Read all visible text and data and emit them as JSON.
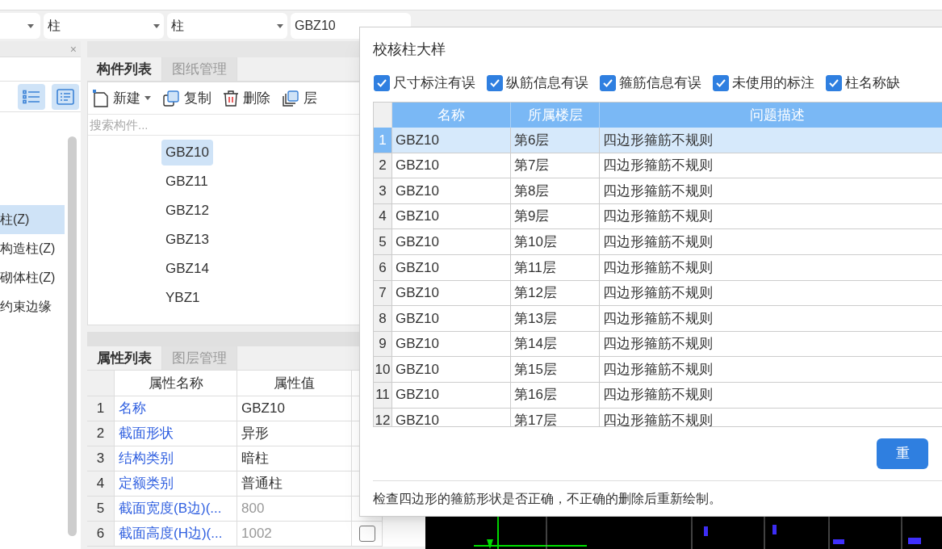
{
  "selectors": [
    {
      "value": "柱"
    },
    {
      "value": "柱"
    },
    {
      "value": "GBZ10"
    }
  ],
  "left_panel": {
    "close": "×",
    "view_buttons": [
      {
        "kind": "list",
        "selected": true
      },
      {
        "kind": "detail",
        "selected": true
      }
    ],
    "items": [
      {
        "label": "柱(Z)",
        "selected": true
      },
      {
        "label": "构造柱(Z)",
        "selected": false
      },
      {
        "label": "砌体柱(Z)",
        "selected": false
      },
      {
        "label": "约束边缘",
        "selected": false
      }
    ]
  },
  "component_panel": {
    "tabs": [
      {
        "label": "构件列表",
        "selected": true
      },
      {
        "label": "图纸管理",
        "selected": false
      }
    ],
    "toolbar": [
      {
        "kind": "new",
        "label": "新建"
      },
      {
        "kind": "copy",
        "label": "复制"
      },
      {
        "kind": "delete",
        "label": "删除"
      },
      {
        "kind": "floor_copy",
        "label": "层"
      }
    ],
    "search": {
      "placeholder": "搜索构件..."
    },
    "items": [
      {
        "label": "GBZ10",
        "selected": true
      },
      {
        "label": "GBZ11",
        "selected": false
      },
      {
        "label": "GBZ12",
        "selected": false
      },
      {
        "label": "GBZ13",
        "selected": false
      },
      {
        "label": "GBZ14",
        "selected": false
      },
      {
        "label": "YBZ1",
        "selected": false
      }
    ]
  },
  "property_panel": {
    "tabs": [
      {
        "label": "属性列表",
        "selected": true
      },
      {
        "label": "图层管理",
        "selected": false
      }
    ],
    "columns": [
      "属性名称",
      "属性值"
    ],
    "rows": [
      {
        "num": "1",
        "name": "名称",
        "value": "GBZ10",
        "disabled": false
      },
      {
        "num": "2",
        "name": "截面形状",
        "value": "异形",
        "disabled": false
      },
      {
        "num": "3",
        "name": "结构类别",
        "value": "暗柱",
        "disabled": false
      },
      {
        "num": "4",
        "name": "定额类别",
        "value": "普通柱",
        "disabled": false
      },
      {
        "num": "5",
        "name": "截面宽度(B边)(...",
        "value": "800",
        "disabled": true
      },
      {
        "num": "6",
        "name": "截面高度(H边)(...",
        "value": "1002",
        "disabled": true,
        "checked": false
      }
    ]
  },
  "dialog": {
    "title": "校核柱大样",
    "filters": [
      {
        "label": "尺寸标注有误",
        "checked": true
      },
      {
        "label": "纵筋信息有误",
        "checked": true
      },
      {
        "label": "箍筋信息有误",
        "checked": true
      },
      {
        "label": "未使用的标注",
        "checked": true
      },
      {
        "label": "柱名称缺",
        "checked": true
      }
    ],
    "columns": [
      "名称",
      "所属楼层",
      "问题描述"
    ],
    "rows": [
      {
        "num": "1",
        "name": "GBZ10",
        "floor": "第6层",
        "problem": "四边形箍筋不规则",
        "selected": true
      },
      {
        "num": "2",
        "name": "GBZ10",
        "floor": "第7层",
        "problem": "四边形箍筋不规则",
        "selected": false
      },
      {
        "num": "3",
        "name": "GBZ10",
        "floor": "第8层",
        "problem": "四边形箍筋不规则",
        "selected": false
      },
      {
        "num": "4",
        "name": "GBZ10",
        "floor": "第9层",
        "problem": "四边形箍筋不规则",
        "selected": false
      },
      {
        "num": "5",
        "name": "GBZ10",
        "floor": "第10层",
        "problem": "四边形箍筋不规则",
        "selected": false
      },
      {
        "num": "6",
        "name": "GBZ10",
        "floor": "第11层",
        "problem": "四边形箍筋不规则",
        "selected": false
      },
      {
        "num": "7",
        "name": "GBZ10",
        "floor": "第12层",
        "problem": "四边形箍筋不规则",
        "selected": false
      },
      {
        "num": "8",
        "name": "GBZ10",
        "floor": "第13层",
        "problem": "四边形箍筋不规则",
        "selected": false
      },
      {
        "num": "9",
        "name": "GBZ10",
        "floor": "第14层",
        "problem": "四边形箍筋不规则",
        "selected": false
      },
      {
        "num": "10",
        "name": "GBZ10",
        "floor": "第15层",
        "problem": "四边形箍筋不规则",
        "selected": false
      },
      {
        "num": "11",
        "name": "GBZ10",
        "floor": "第16层",
        "problem": "四边形箍筋不规则",
        "selected": false
      },
      {
        "num": "12",
        "name": "GBZ10",
        "floor": "第17层",
        "problem": "四边形箍筋不规则",
        "selected": false
      }
    ],
    "button": "重",
    "hint": "检查四边形的箍筋形状是否正确，不正确的删除后重新绘制。"
  }
}
